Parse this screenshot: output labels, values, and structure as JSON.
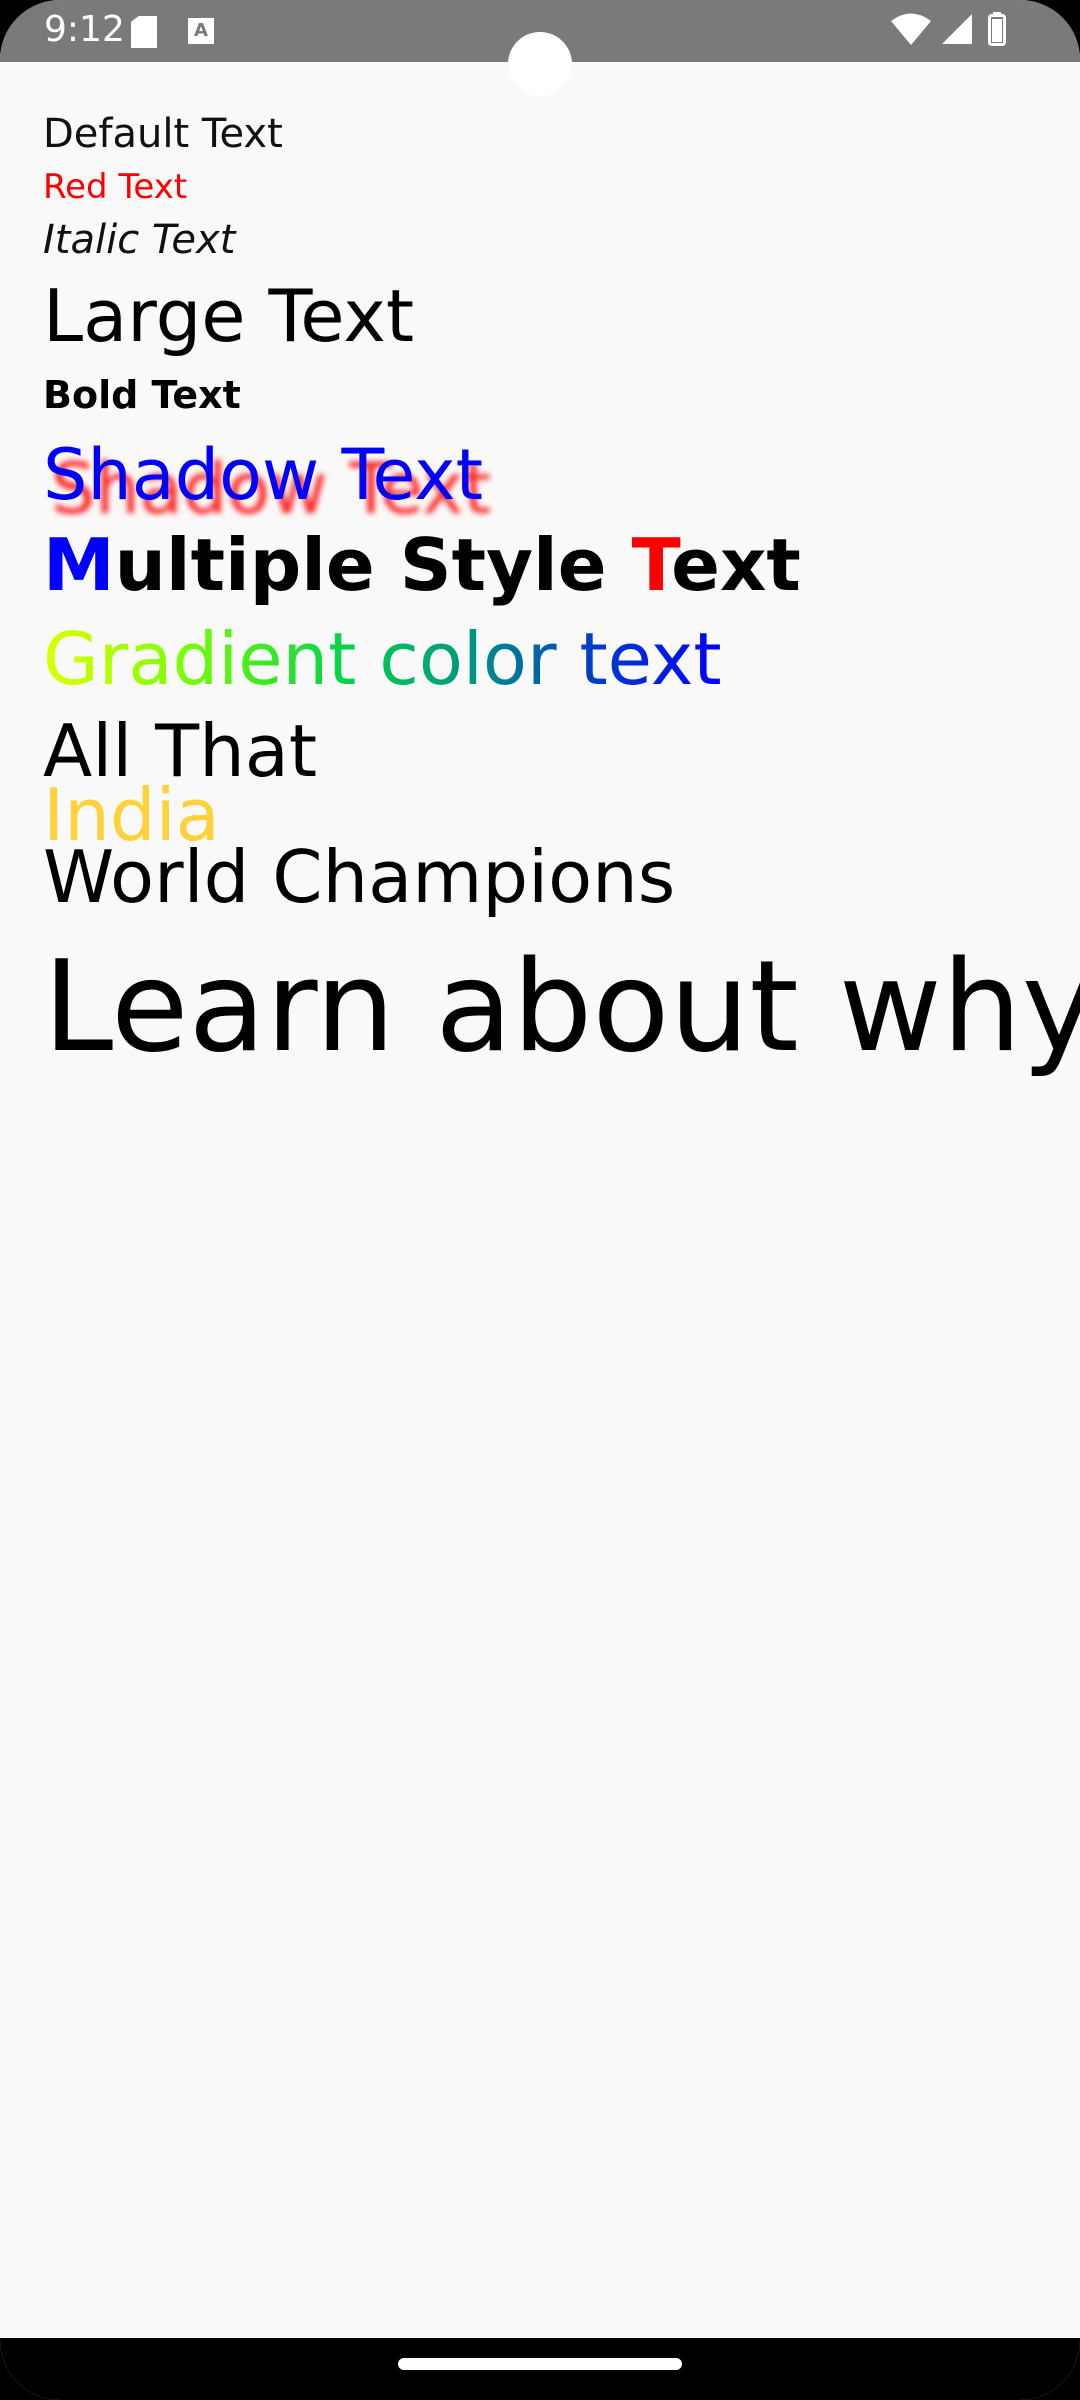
{
  "status_bar": {
    "time": "9:12",
    "icons": [
      "sd-card-icon",
      "a-icon",
      "wifi-icon",
      "signal-icon",
      "battery-icon"
    ],
    "a_icon_text": "A",
    "background": "#7a7a7a"
  },
  "texts": {
    "default": "Default Text",
    "red": "Red Text",
    "italic": "Italic Text",
    "large": "Large Text",
    "bold": "Bold Text",
    "shadow": "Shadow Text",
    "multiple_style": {
      "part1": "M",
      "part2": "ultiple Style ",
      "part3": "T",
      "part4": "ext"
    },
    "gradient": "Gradient color text",
    "all_that": "All That",
    "india": "India",
    "world_champions": "World Champions",
    "learn": "Learn about why"
  },
  "colors": {
    "red_text": "#ff0000",
    "shadow_text": "#0000ff",
    "shadow_color": "#ff0000",
    "india": "#ffd13a",
    "gradient": [
      "#dfff00",
      "#7cff00",
      "#00d24a",
      "#009a7a",
      "#0040c8",
      "#0000ff"
    ]
  }
}
